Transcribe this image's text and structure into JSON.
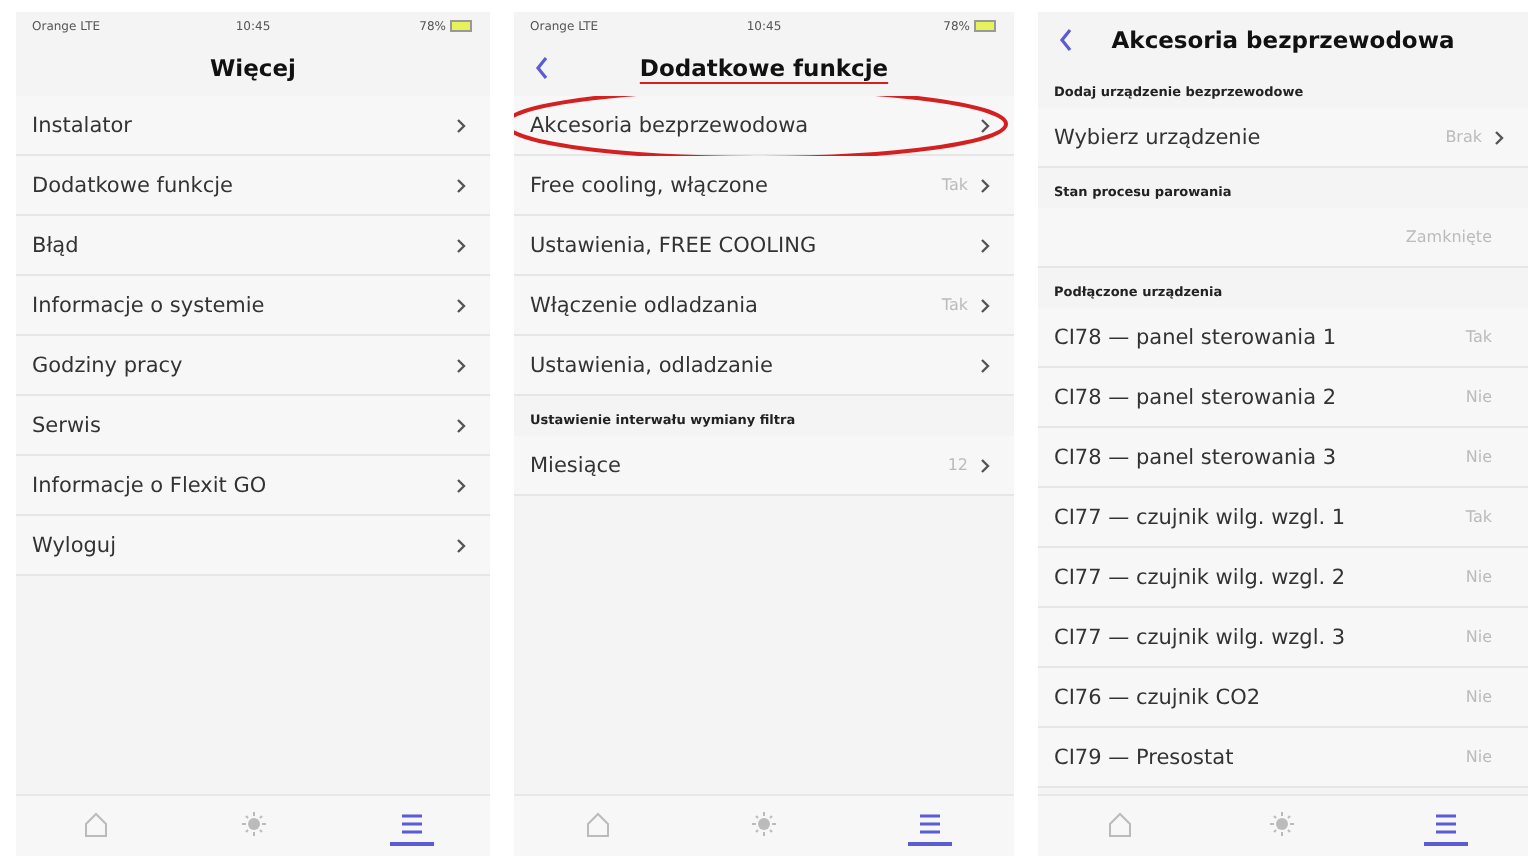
{
  "phones": [
    {
      "status": {
        "carrier": "Orange LTE",
        "time": "10:45",
        "battery": "78%"
      },
      "title": "Więcej",
      "sections": [
        {
          "rows": [
            {
              "label": "Instalator",
              "chevron": true,
              "annotated": false
            },
            {
              "label": "Dodatkowe funkcje",
              "chevron": true,
              "annotated": false
            },
            {
              "label": "Błąd",
              "chevron": true,
              "annotated": false
            },
            {
              "label": "Informacje o systemie",
              "chevron": true,
              "annotated": false
            },
            {
              "label": "Godziny pracy",
              "chevron": true,
              "annotated": false
            },
            {
              "label": "Serwis",
              "chevron": true,
              "annotated": false
            },
            {
              "label": "Informacje o Flexit GO",
              "chevron": true,
              "annotated": false
            },
            {
              "label": "Wyloguj",
              "chevron": true,
              "annotated": false
            }
          ]
        }
      ],
      "tabs": [
        {
          "kind": "home",
          "selected": false
        },
        {
          "kind": "sun",
          "selected": false
        },
        {
          "kind": "menu",
          "selected": true
        }
      ]
    },
    {
      "status": {
        "carrier": "Orange LTE",
        "time": "10:45",
        "battery": "78%"
      },
      "title": "Dodatkowe funkcje",
      "title_underlined": true,
      "back": true,
      "sections": [
        {
          "rows": [
            {
              "label": "Akcesoria bezprzewodowa",
              "chevron": true,
              "annotated": true
            },
            {
              "label": "Free cooling, włączone",
              "value": "Tak",
              "chevron": true,
              "annotated": false
            },
            {
              "label": "Ustawienia, FREE COOLING",
              "chevron": true,
              "annotated": false
            },
            {
              "label": "Włączenie odladzania",
              "value": "Tak",
              "chevron": true,
              "annotated": false
            },
            {
              "label": "Ustawienia, odladzanie",
              "chevron": true,
              "annotated": false
            }
          ]
        },
        {
          "header": "Ustawienie interwału wymiany filtra",
          "rows": [
            {
              "label": "Miesiące",
              "value": "12",
              "chevron": true,
              "annotated": false
            }
          ]
        }
      ],
      "tabs": [
        {
          "kind": "home",
          "selected": false
        },
        {
          "kind": "sun",
          "selected": false
        },
        {
          "kind": "menu",
          "selected": true
        }
      ]
    },
    {
      "title": "Akcesoria bezprzewodowa",
      "title_underlined": false,
      "back": true,
      "sections": [
        {
          "header": "Dodaj urządzenie bezprzewodowe",
          "rows": [
            {
              "label": "Wybierz urządzenie",
              "value": "Brak",
              "chevron": true,
              "annotated": false
            }
          ]
        },
        {
          "header": "Stan procesu parowania",
          "rows": [
            {
              "value": "Zamknięte",
              "chevron": false,
              "annotated": false
            }
          ]
        },
        {
          "header": "Podłączone urządzenia",
          "rows": [
            {
              "label": "CI78 — panel sterowania 1",
              "value": "Tak",
              "chevron": false,
              "annotated": false
            },
            {
              "label": "CI78 — panel sterowania 2",
              "value": "Nie",
              "chevron": false,
              "annotated": false
            },
            {
              "label": "CI78 — panel sterowania 3",
              "value": "Nie",
              "chevron": false,
              "annotated": false
            },
            {
              "label": "CI77 — czujnik wilg. wzgl. 1",
              "value": "Tak",
              "chevron": false,
              "annotated": false
            },
            {
              "label": "CI77 — czujnik wilg. wzgl. 2",
              "value": "Nie",
              "chevron": false,
              "annotated": false
            },
            {
              "label": "CI77 — czujnik wilg. wzgl. 3",
              "value": "Nie",
              "chevron": false,
              "annotated": false
            },
            {
              "label": "CI76 — czujnik CO2",
              "value": "Nie",
              "chevron": false,
              "annotated": false
            },
            {
              "label": "CI79 — Presostat",
              "value": "Nie",
              "chevron": false,
              "annotated": false
            }
          ]
        }
      ],
      "tabs": [
        {
          "kind": "home",
          "selected": false
        },
        {
          "kind": "sun",
          "selected": false
        },
        {
          "kind": "menu",
          "selected": true
        }
      ]
    }
  ]
}
